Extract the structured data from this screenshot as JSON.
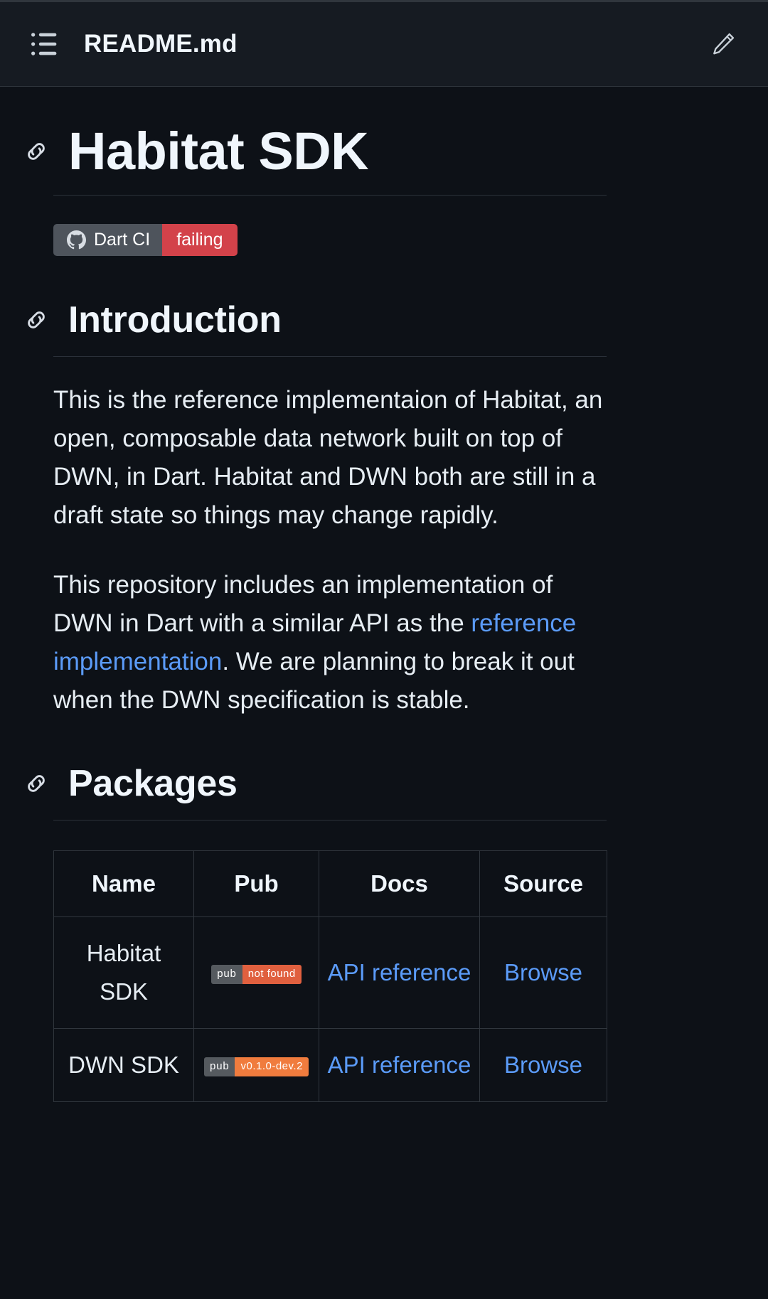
{
  "theme": {
    "background": "#0d1117",
    "header_background": "#161b22",
    "text": "#e6edf3",
    "heading": "#f0f6fc",
    "link": "#5b9bf8",
    "border": "#30363d",
    "badge_gray": "#4e545c",
    "badge_red": "#d3424a",
    "badge_orange": "#f07c3e",
    "badge_orange_red": "#e0603f"
  },
  "header": {
    "title": "README.md",
    "outline_icon": "list-icon",
    "edit_icon": "pencil-icon"
  },
  "document": {
    "title": "Habitat SDK",
    "anchor_icon": "link-icon",
    "ci_badge": {
      "icon": "github-icon",
      "label": "Dart CI",
      "status": "failing"
    },
    "sections": [
      {
        "heading": "Introduction",
        "paragraphs": [
          {
            "parts": [
              {
                "type": "text",
                "value": "This is the reference implementaion of Habitat, an open, composable data network built on top of DWN, in Dart. Habitat and DWN both are still in a draft state so things may change rapidly."
              }
            ]
          },
          {
            "parts": [
              {
                "type": "text",
                "value": "This repository includes an implementation of DWN in Dart with a similar API as the "
              },
              {
                "type": "link",
                "value": "reference implementation"
              },
              {
                "type": "text",
                "value": ". We are planning to break it out when the DWN specification is stable."
              }
            ]
          }
        ]
      },
      {
        "heading": "Packages"
      }
    ]
  },
  "packages_table": {
    "columns": [
      "Name",
      "Pub",
      "Docs",
      "Source"
    ],
    "rows": [
      {
        "name": "Habitat SDK",
        "pub": {
          "left": "pub",
          "right": "not found",
          "style": "notfound"
        },
        "docs": "API reference",
        "source": "Browse"
      },
      {
        "name": "DWN SDK",
        "pub": {
          "left": "pub",
          "right": "v0.1.0-dev.2",
          "style": "version"
        },
        "docs": "API reference",
        "source": "Browse"
      }
    ]
  }
}
